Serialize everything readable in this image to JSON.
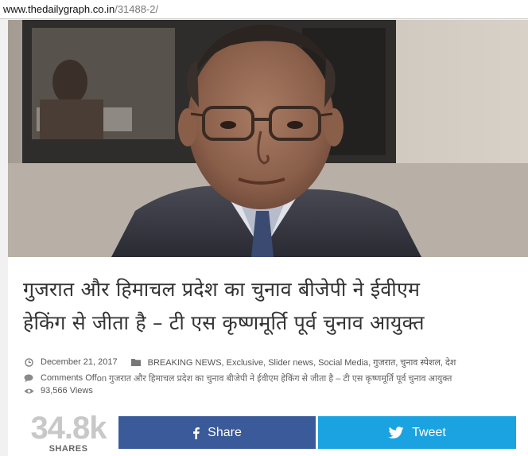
{
  "browser": {
    "url_host": "www.thedailygraph.co.in",
    "url_path": "/31488-2/"
  },
  "article": {
    "image_alt_subject": "portrait photo",
    "title_line1": "गुजरात और हिमाचल प्रदेश का चुनाव बीजेपी ने ईवीएम",
    "title_line2": "हेकिंग से जीता है – टी एस कृष्णमूर्ति पूर्व चुनाव आयुक्त",
    "date": "December 21, 2017",
    "categories": "BREAKING NEWS, Exclusive, Slider news, Social Media, गुजरात, चुनाव स्पेशल, देश",
    "comments_prefix": "Comments Off",
    "comments_on": "on गुजरात और हिमाचल प्रदेश का चुनाव बीजेपी ने ईवीएम हेकिंग से जीता है – टी एस कृष्णमूर्ति पूर्व चुनाव आयुक्त",
    "views": "93,566 Views"
  },
  "share": {
    "count": "34.8k",
    "count_label": "SHARES",
    "facebook_label": "Share",
    "twitter_label": "Tweet",
    "facebook_color": "#3b5a9a",
    "twitter_color": "#1aa3e0",
    "facebook_icon": "facebook-icon",
    "twitter_icon": "twitter-icon"
  },
  "icons": {
    "date": "clock-icon",
    "categories": "folder-icon",
    "comments": "comment-icon",
    "views": "eye-icon"
  }
}
